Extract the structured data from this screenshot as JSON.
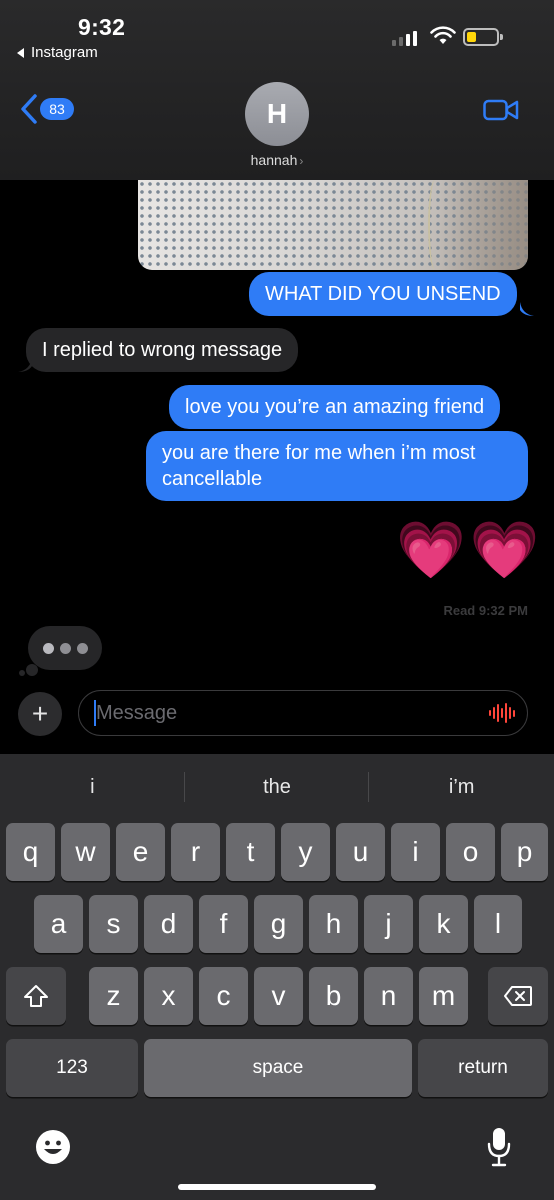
{
  "status_bar": {
    "time": "9:32",
    "back_app": "Instagram"
  },
  "header": {
    "back_count": "83",
    "avatar_initial": "H",
    "contact_name": "hannah",
    "accent_color": "#2f7cf6"
  },
  "messages": [
    {
      "type": "sent",
      "text": "WHAT DID YOU UNSEND"
    },
    {
      "type": "received",
      "text": "I replied to wrong message"
    },
    {
      "type": "sent",
      "text": "love you you’re an amazing friend"
    },
    {
      "type": "sent",
      "text": "you are there for me when i’m most cancellable"
    },
    {
      "type": "sent",
      "text": "💗💗"
    }
  ],
  "read_receipt": "Read 9:32 PM",
  "composer": {
    "placeholder": "Message"
  },
  "keyboard": {
    "suggestions": [
      "i",
      "the",
      "i’m"
    ],
    "row1": [
      "q",
      "w",
      "e",
      "r",
      "t",
      "y",
      "u",
      "i",
      "o",
      "p"
    ],
    "row2": [
      "a",
      "s",
      "d",
      "f",
      "g",
      "h",
      "j",
      "k",
      "l"
    ],
    "row3": [
      "z",
      "x",
      "c",
      "v",
      "b",
      "n",
      "m"
    ],
    "numbers_label": "123",
    "space_label": "space",
    "return_label": "return"
  }
}
